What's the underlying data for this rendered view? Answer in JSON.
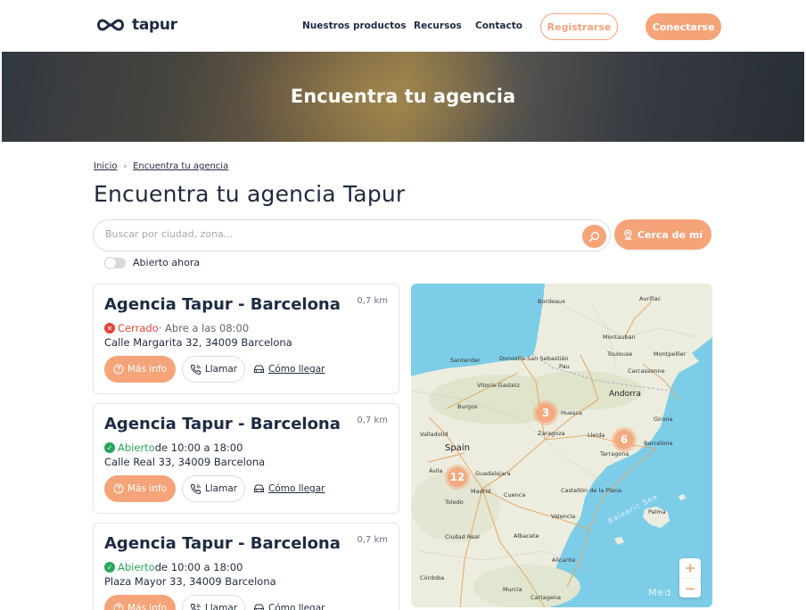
{
  "header": {
    "brand": "tapur",
    "nav": [
      "Nuestros productos",
      "Recursos",
      "Contacto"
    ],
    "register_label": "Registrarse",
    "connect_label": "Conectarse"
  },
  "hero": {
    "title": "Encuentra tu agencia"
  },
  "breadcrumb": {
    "home": "Inicio",
    "current": "Encuentra tu agencia",
    "separator": "›"
  },
  "page_title": "Encuentra tu agencia Tapur",
  "search": {
    "placeholder": "Buscar por ciudad, zona...",
    "value": "",
    "near_label": "Cerca de mí"
  },
  "filter": {
    "label": "Abierto ahora",
    "checked": false
  },
  "agencies": [
    {
      "name": "Agencia Tapur - Barcelona",
      "distance": "0,7 km",
      "status": "Cerrado",
      "status_type": "closed",
      "hours": " · Abre a las 08:00",
      "address": "Calle Margarita 32, 34009 Barcelona",
      "info_label": "Más info",
      "call_label": "Llamar",
      "route_label": "Cómo llegar"
    },
    {
      "name": "Agencia Tapur - Barcelona",
      "distance": "0,7 km",
      "status": "Abierto",
      "status_type": "open",
      "hours": " de 10:00 a 18:00",
      "address": "Calle Real 33, 34009 Barcelona",
      "info_label": "Más info",
      "call_label": "Llamar",
      "route_label": "Cómo llegar"
    },
    {
      "name": "Agencia Tapur - Barcelona",
      "distance": "0,7 km",
      "status": "Abierto",
      "status_type": "open",
      "hours": " de 10:00 a 18:00",
      "address": "Plaza Mayor 33, 34009 Barcelona",
      "info_label": "Más info",
      "call_label": "Llamar",
      "route_label": "Cómo llegar"
    }
  ],
  "map": {
    "clusters": [
      "3",
      "6",
      "12"
    ],
    "zoom_in": "+",
    "zoom_out": "−",
    "country_label": "Spain",
    "andorra_label": "Andorra",
    "sea_label": "Balearic Sea",
    "sea_label_2": "Med",
    "cities": [
      "Bordeaux",
      "Aurillac",
      "Montauban",
      "Toulouse",
      "Montpellier",
      "Santander",
      "Donostia-San Sebastián",
      "Pau",
      "Carcassonne",
      "Vitoria-Gasteiz",
      "Burgos",
      "Huesca",
      "Girona",
      "Valladolid",
      "Zaragoza",
      "Lleida",
      "Barcelona",
      "Tarragona",
      "Ávila",
      "Guadalajara",
      "Madrid",
      "Cuenca",
      "Castellón de la Plana",
      "Toledo",
      "Valencia",
      "Palma",
      "Ciudad Real",
      "Albacete",
      "Alicante",
      "Córdoba",
      "Murcia",
      "Cartagena"
    ],
    "colors": {
      "water": "#7dcde8",
      "land": "#eceddf",
      "roads": "#e4a663",
      "cluster": "#f4a478"
    }
  },
  "colors": {
    "accent": "#f4a478",
    "text": "#1d2b44",
    "closed": "#e0443a",
    "open": "#27a559"
  }
}
